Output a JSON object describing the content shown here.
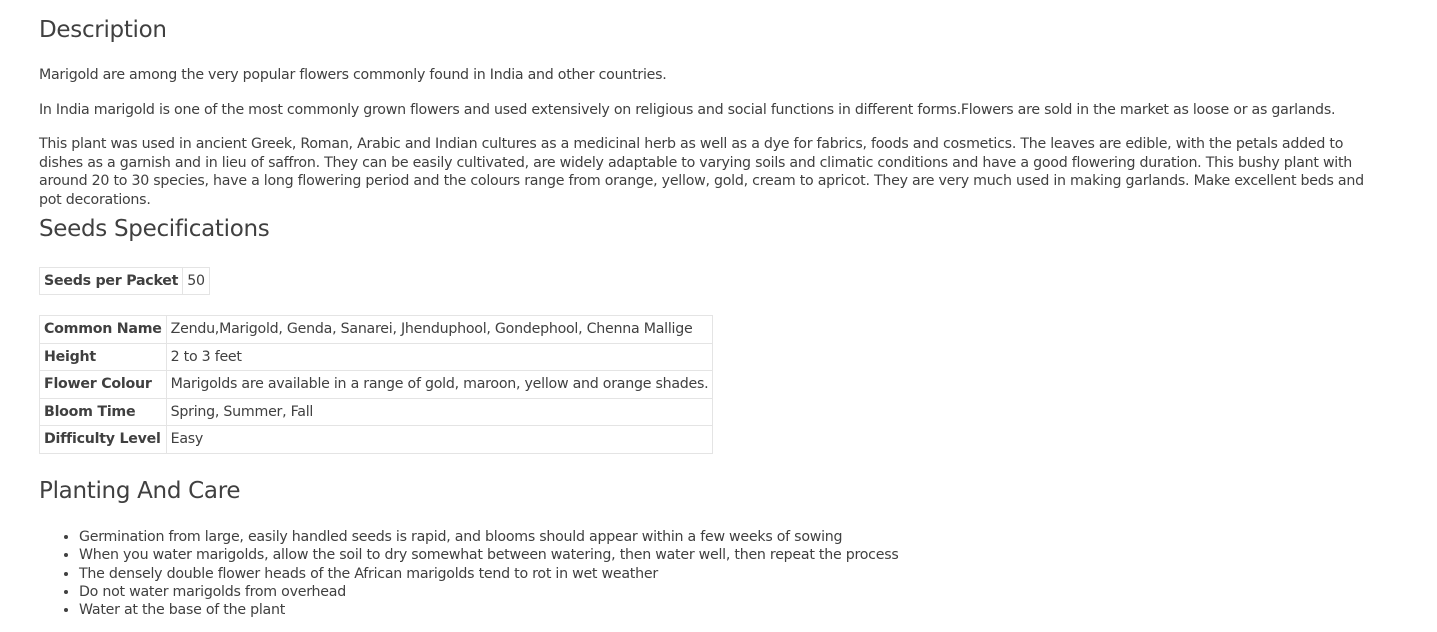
{
  "description": {
    "title": "Description",
    "paragraphs": [
      "Marigold are among the very popular flowers commonly found in India and other countries.",
      "In India marigold is one of the most commonly grown flowers and used extensively on religious and social functions in different forms.Flowers are sold in the market as loose or as garlands.",
      "This plant was used in ancient Greek, Roman, Arabic and Indian cultures as a medicinal herb as well as a dye for fabrics, foods and cosmetics. The leaves are edible, with the petals added to dishes as a garnish and in lieu of saffron. They can be easily cultivated, are widely adaptable to varying soils and climatic conditions and have a good flowering duration. This bushy plant with around 20 to 30 species, have a long flowering period and the colours range from orange, yellow, gold, cream to apricot. They are very much used in making garlands. Make excellent beds and pot decorations."
    ]
  },
  "specifications": {
    "title": "Seeds Specifications",
    "packet": {
      "label": "Seeds per Packet",
      "value": "50"
    },
    "rows": [
      {
        "label": "Common Name",
        "value": "Zendu,Marigold, Genda, Sanarei, Jhenduphool, Gondephool, Chenna Mallige"
      },
      {
        "label": "Height",
        "value": "2 to 3 feet"
      },
      {
        "label": "Flower Colour",
        "value": "Marigolds are available in a range of gold, maroon, yellow and orange shades."
      },
      {
        "label": "Bloom Time",
        "value": "Spring, Summer, Fall"
      },
      {
        "label": "Difficulty Level",
        "value": "Easy"
      }
    ]
  },
  "care": {
    "title": "Planting And Care",
    "items": [
      "Germination from large, easily handled seeds is rapid, and blooms should appear within a few weeks of sowing",
      "When you water marigolds, allow the soil to dry somewhat between watering, then water well, then repeat the process",
      "The densely double flower heads of the African marigolds tend to rot in wet weather",
      "Do not water marigolds from overhead",
      "Water at the base of the plant"
    ]
  }
}
